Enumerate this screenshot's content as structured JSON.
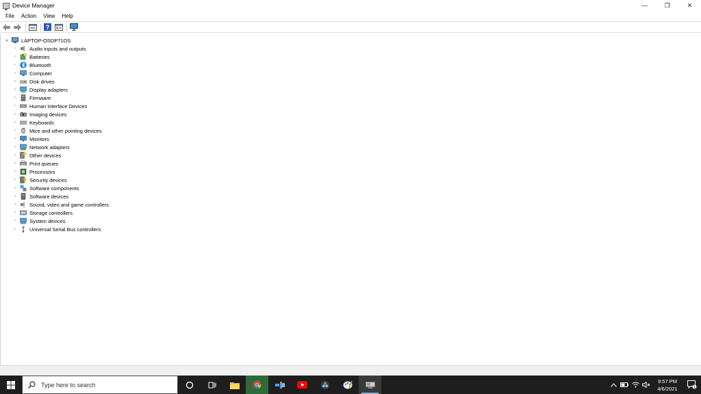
{
  "window": {
    "title": "Device Manager",
    "controls": {
      "minimize": "—",
      "restore": "❐",
      "close": "✕"
    }
  },
  "menubar": {
    "items": [
      "File",
      "Action",
      "View",
      "Help"
    ]
  },
  "toolbar": {
    "buttons": [
      "back-icon",
      "forward-icon",
      "properties-icon",
      "help-icon",
      "show-hide-icon",
      "monitor-icon"
    ]
  },
  "tree": {
    "root": "LAPTOP-OSDP71OS",
    "categories": [
      {
        "label": "Audio inputs and outputs",
        "icon": "speaker-icon"
      },
      {
        "label": "Batteries",
        "icon": "battery-icon"
      },
      {
        "label": "Bluetooth",
        "icon": "bluetooth-icon"
      },
      {
        "label": "Computer",
        "icon": "computer-icon"
      },
      {
        "label": "Disk drives",
        "icon": "disk-drive-icon"
      },
      {
        "label": "Display adapters",
        "icon": "display-adapter-icon"
      },
      {
        "label": "Firmware",
        "icon": "firmware-icon"
      },
      {
        "label": "Human Interface Devices",
        "icon": "hid-icon"
      },
      {
        "label": "Imaging devices",
        "icon": "camera-icon"
      },
      {
        "label": "Keyboards",
        "icon": "keyboard-icon"
      },
      {
        "label": "Mice and other pointing devices",
        "icon": "mouse-icon"
      },
      {
        "label": "Monitors",
        "icon": "monitor-icon"
      },
      {
        "label": "Network adapters",
        "icon": "network-adapter-icon"
      },
      {
        "label": "Other devices",
        "icon": "other-device-icon"
      },
      {
        "label": "Print queues",
        "icon": "printer-icon"
      },
      {
        "label": "Processors",
        "icon": "processor-icon"
      },
      {
        "label": "Security devices",
        "icon": "security-device-icon"
      },
      {
        "label": "Software components",
        "icon": "software-component-icon"
      },
      {
        "label": "Software devices",
        "icon": "software-device-icon"
      },
      {
        "label": "Sound, video and game controllers",
        "icon": "sound-icon"
      },
      {
        "label": "Storage controllers",
        "icon": "storage-controller-icon"
      },
      {
        "label": "System devices",
        "icon": "system-device-icon"
      },
      {
        "label": "Universal Serial Bus controllers",
        "icon": "usb-icon"
      }
    ]
  },
  "taskbar": {
    "search_placeholder": "Type here to search",
    "apps": [
      "cortana-icon",
      "task-view-icon",
      "file-explorer-icon",
      "chrome-icon",
      "app-icon",
      "youtube-icon",
      "davinci-resolve-icon",
      "paint-icon",
      "device-manager-icon"
    ],
    "time": "9:57 PM",
    "date": "4/6/2021",
    "notification_count": "1"
  },
  "colors": {
    "taskbar": "#1e1e1e",
    "accent": "#1f7ad4"
  }
}
